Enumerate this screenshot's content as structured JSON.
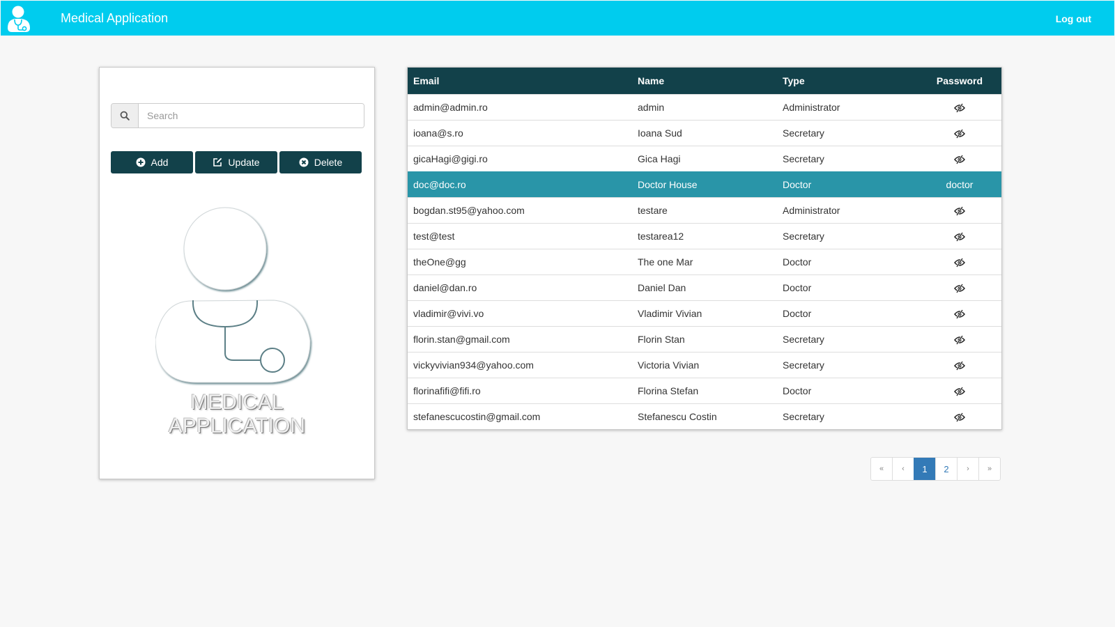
{
  "navbar": {
    "title": "Medical Application",
    "logout_label": "Log out",
    "color": "#00ccee"
  },
  "side_panel": {
    "search": {
      "placeholder": "Search",
      "value": ""
    },
    "buttons": [
      {
        "label": "Add",
        "icon": "plus-circle-icon"
      },
      {
        "label": "Update",
        "icon": "edit-icon"
      },
      {
        "label": "Delete",
        "icon": "times-circle-icon"
      }
    ],
    "watermark": [
      "MEDICAL",
      "APPLICATION"
    ]
  },
  "table": {
    "header_color": "#12414a",
    "selected_color": "#2995a8",
    "columns": [
      "Email",
      "Name",
      "Type",
      "Password"
    ],
    "rows": [
      {
        "email": "admin@admin.ro",
        "name": "admin",
        "type": "Administrator",
        "password": ""
      },
      {
        "email": "ioana@s.ro",
        "name": "Ioana Sud",
        "type": "Secretary",
        "password": ""
      },
      {
        "email": "gicaHagi@gigi.ro",
        "name": "Gica Hagi",
        "type": "Secretary",
        "password": ""
      },
      {
        "email": "doc@doc.ro",
        "name": "Doctor House",
        "type": "Doctor",
        "password": "doctor",
        "selected": true
      },
      {
        "email": "bogdan.st95@yahoo.com",
        "name": "testare",
        "type": "Administrator",
        "password": ""
      },
      {
        "email": "test@test",
        "name": "testarea12",
        "type": "Secretary",
        "password": ""
      },
      {
        "email": "theOne@gg",
        "name": "The one Mar",
        "type": "Doctor",
        "password": ""
      },
      {
        "email": "daniel@dan.ro",
        "name": "Daniel Dan",
        "type": "Doctor",
        "password": ""
      },
      {
        "email": "vladimir@vivi.vo",
        "name": "Vladimir Vivian",
        "type": "Doctor",
        "password": ""
      },
      {
        "email": "florin.stan@gmail.com",
        "name": "Florin Stan",
        "type": "Secretary",
        "password": ""
      },
      {
        "email": "vickyvivian934@yahoo.com",
        "name": "Victoria Vivian",
        "type": "Secretary",
        "password": ""
      },
      {
        "email": "florinafifi@fifi.ro",
        "name": "Florina Stefan",
        "type": "Doctor",
        "password": ""
      },
      {
        "email": "stefanescucostin@gmail.com",
        "name": "Stefanescu Costin",
        "type": "Secretary",
        "password": ""
      }
    ]
  },
  "pagination": {
    "first": "«",
    "prev": "‹",
    "pages": [
      "1",
      "2"
    ],
    "active_page": "1",
    "next": "›",
    "last": "»"
  }
}
